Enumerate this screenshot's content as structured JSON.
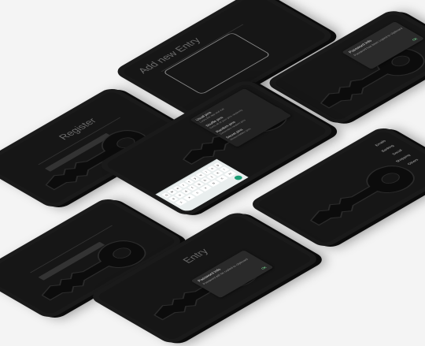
{
  "screens": {
    "add_entry": {
      "title": "Add new Entry"
    },
    "password_card": {
      "title": "Password Info",
      "subtitle": "Password has been copied to clipboard",
      "action": "OK"
    },
    "register": {
      "title": "Register"
    },
    "center_menu": {
      "items": [
        {
          "label": "Usual pins",
          "desc": "Locks the app and exit"
        },
        {
          "label": "Shuffle pins",
          "desc": "Sorts all of your pins randomly"
        },
        {
          "label": "Random pins",
          "desc": "Generates random pins"
        },
        {
          "label": "Secret pins",
          "desc": "Shows hidden pins"
        }
      ]
    },
    "right_list": {
      "items": [
        "Emails",
        "Banking",
        "Social",
        "Shopping",
        "Others"
      ]
    },
    "entry": {
      "title": "Entry"
    },
    "entry_card": {
      "title": "Password Info",
      "subtitle": "Password will be copied to clipboard",
      "action": "OK"
    }
  },
  "keyboard": {
    "rows": [
      [
        "q",
        "w",
        "e",
        "r",
        "t",
        "y",
        "u",
        "i",
        "o",
        "p"
      ],
      [
        "a",
        "s",
        "d",
        "f",
        "g",
        "h",
        "j",
        "k",
        "l"
      ],
      [
        "z",
        "x",
        "c",
        "v",
        "b",
        "n",
        "m"
      ]
    ]
  },
  "colors": {
    "background": "#f4f4f4",
    "phone": "#1a1a1a",
    "screen": "#161616",
    "accent": "#1e9e76"
  }
}
